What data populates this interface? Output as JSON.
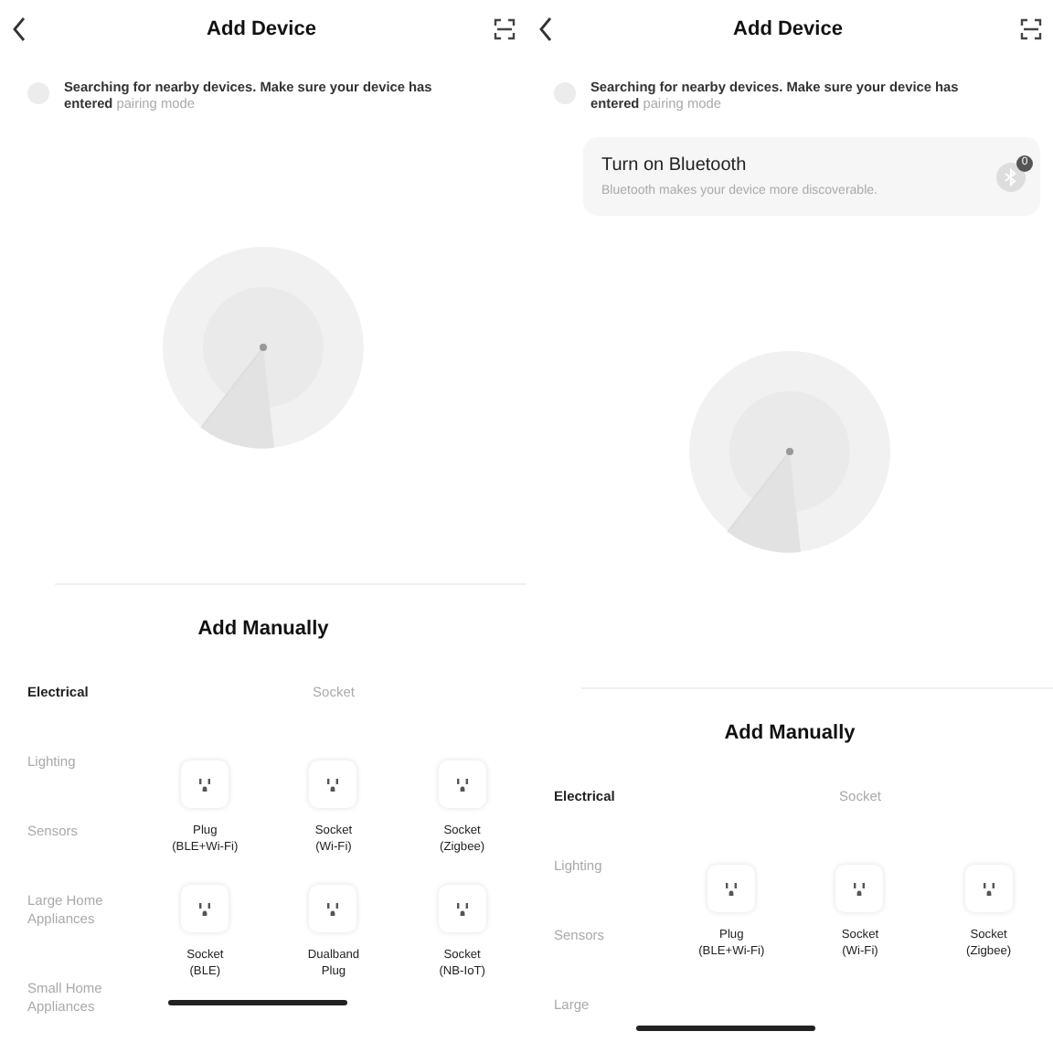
{
  "screens": [
    {
      "title": "Add Device",
      "searching": {
        "text": "Searching for nearby devices. Make sure your device has entered",
        "link": "pairing mode"
      },
      "manual": {
        "title": "Add Manually",
        "categories": [
          {
            "label": "Electrical",
            "selected": true
          },
          {
            "label": "Lighting",
            "selected": false
          },
          {
            "label": "Sensors",
            "selected": false
          },
          {
            "label": "Large Home Appliances",
            "selected": false
          },
          {
            "label": "Small Home Appliances",
            "selected": false
          }
        ],
        "subcategory": "Socket",
        "products": [
          {
            "label": "Plug\n(BLE+Wi-Fi)"
          },
          {
            "label": "Socket\n(Wi-Fi)"
          },
          {
            "label": "Socket\n(Zigbee)"
          },
          {
            "label": "Socket\n(BLE)"
          },
          {
            "label": "Dualband\nPlug"
          },
          {
            "label": "Socket\n(NB-IoT)"
          }
        ]
      }
    },
    {
      "title": "Add Device",
      "searching": {
        "text": "Searching for nearby devices. Make sure your device has entered",
        "link": "pairing mode"
      },
      "bluetooth_card": {
        "title": "Turn on Bluetooth",
        "subtitle": "Bluetooth makes your device more discoverable.",
        "badge": "0"
      },
      "manual": {
        "title": "Add Manually",
        "categories": [
          {
            "label": "Electrical",
            "selected": true
          },
          {
            "label": "Lighting",
            "selected": false
          },
          {
            "label": "Sensors",
            "selected": false
          },
          {
            "label": "Large",
            "selected": false
          }
        ],
        "subcategory": "Socket",
        "products": [
          {
            "label": "Plug\n(BLE+Wi-Fi)"
          },
          {
            "label": "Socket\n(Wi-Fi)"
          },
          {
            "label": "Socket\n(Zigbee)"
          }
        ]
      }
    }
  ]
}
